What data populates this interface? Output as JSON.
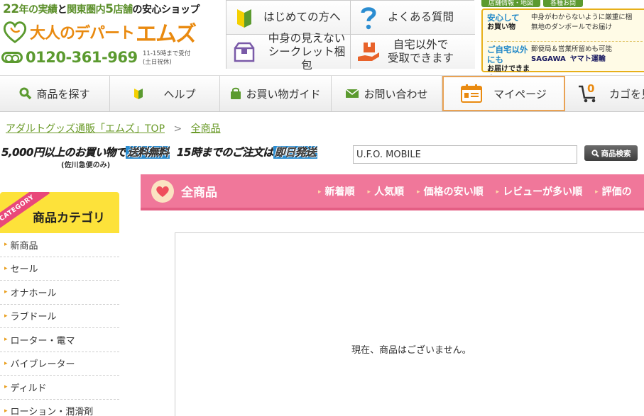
{
  "header": {
    "tagline_num1": "22",
    "tagline_part1": "年の実績",
    "tagline_part2": "と",
    "tagline_part3": "関東圏内",
    "tagline_num2": "5",
    "tagline_part4": "店舗",
    "tagline_part5": "の安心ショップ",
    "logo_text": "大人のデパート",
    "logo_em": "エムズ",
    "phone": "0120-361-969",
    "hours_line1": "11-15時まで受付",
    "hours_line2": "(土日祝休)"
  },
  "help_links": [
    {
      "label": "はじめての方へ",
      "icon": "beginner-icon"
    },
    {
      "label": "よくある質問",
      "icon": "question-icon"
    },
    {
      "label": "中身の見えない\nシークレット梱包",
      "icon": "box-icon"
    },
    {
      "label": "自宅以外で\n受取できます",
      "icon": "hand-package-icon"
    }
  ],
  "right_top": {
    "tab1": "店舗情報・地図",
    "tab2": "各種お問",
    "row1_head1": "安心して",
    "row1_head2": "お買い物",
    "row1_text1": "中身がわからないように厳重に梱",
    "row1_text2": "無地のダンボールでお届け",
    "row2_head1": "ご自宅以外にも",
    "row2_head2": "お届けできます",
    "row2_text1": "郵便局＆営業所留めも可能",
    "carrier1": "SAGAWA",
    "carrier2": "ヤマト運輸"
  },
  "nav": {
    "search": "商品を探す",
    "help": "ヘルプ",
    "guide": "お買い物ガイド",
    "contact": "お問い合わせ",
    "mypage": "マイページ",
    "cart": "カゴを見る",
    "cart_count": "0"
  },
  "breadcrumb": {
    "home": "アダルトグッズ通販「エムズ」TOP",
    "sep": ">",
    "current": "全商品"
  },
  "promo": {
    "part1": "5,000円以上のお買い物で",
    "part2": "送料無料",
    "part3": "15時までのご注文は",
    "part4": "即日発送",
    "note": "(佐川急便のみ)"
  },
  "search": {
    "value": "U.F.O. MOBILE",
    "button": "商品検索"
  },
  "category": {
    "title": "全商品",
    "sorts": [
      "新着順",
      "人気順",
      "価格の安い順",
      "レビューが多い順",
      "評価の"
    ]
  },
  "sidebar": {
    "ribbon": "CATEGORY",
    "title": "商品カテゴリ",
    "items": [
      "新商品",
      "セール",
      "オナホール",
      "ラブドール",
      "ローター・電マ",
      "バイブレーター",
      "ディルド",
      "ローション・潤滑剤"
    ]
  },
  "content": {
    "empty_message": "現在、商品はございません。"
  },
  "colors": {
    "accent_green": "#5b9a2f",
    "accent_pink": "#f0779a",
    "accent_yellow": "#fde23a",
    "logo_orange": "#e98a10"
  }
}
